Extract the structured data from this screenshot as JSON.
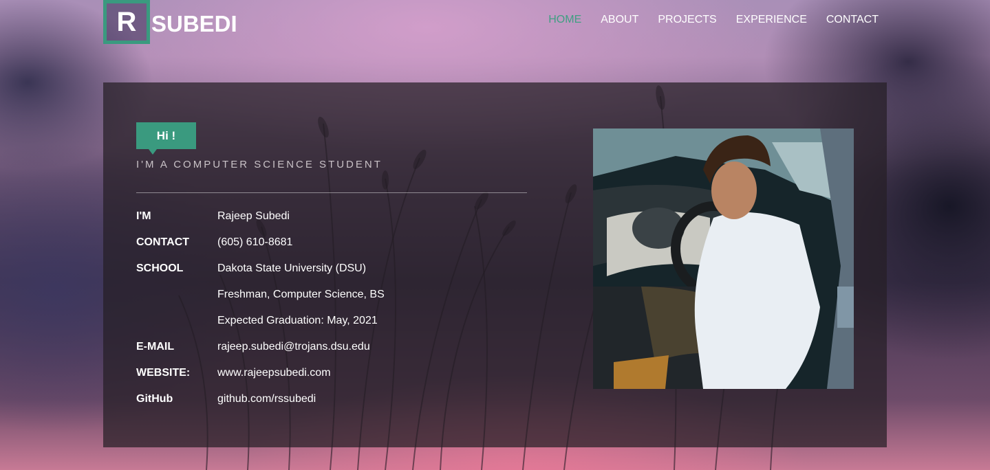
{
  "logo": {
    "letter": "R",
    "text": "SUBEDI"
  },
  "nav": {
    "items": [
      {
        "label": "HOME",
        "active": true
      },
      {
        "label": "ABOUT",
        "active": false
      },
      {
        "label": "PROJECTS",
        "active": false
      },
      {
        "label": "EXPERIENCE",
        "active": false
      },
      {
        "label": "CONTACT",
        "active": false
      }
    ]
  },
  "intro": {
    "badge": "Hi !",
    "subtitle": "I'M A COMPUTER SCIENCE STUDENT"
  },
  "info": [
    {
      "label": "I'M",
      "value": "Rajeep Subedi"
    },
    {
      "label": "CONTACT",
      "value": "(605) 610-8681"
    },
    {
      "label": "SCHOOL",
      "value": "Dakota State University (DSU)"
    },
    {
      "label": "",
      "value": "Freshman, Computer Science, BS"
    },
    {
      "label": "",
      "value": "Expected Graduation: May, 2021"
    },
    {
      "label": "E-MAIL",
      "value": "rajeep.subedi@trojans.dsu.edu"
    },
    {
      "label": "WEBSITE:",
      "value": "www.rajeepsubedi.com"
    },
    {
      "label": "GitHub",
      "value": "github.com/rssubedi"
    }
  ],
  "colors": {
    "accent": "#3a9a7f",
    "nav_active": "#3f9f82"
  }
}
